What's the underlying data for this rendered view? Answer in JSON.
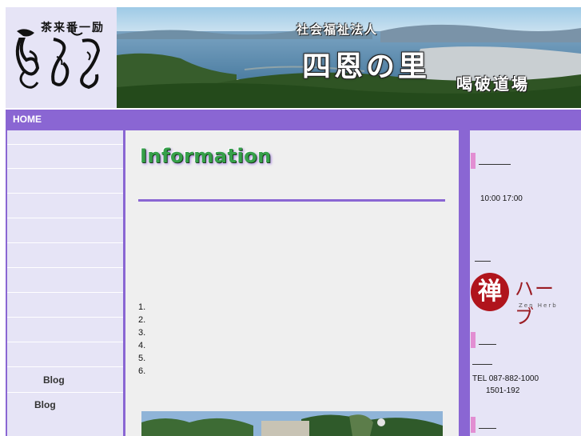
{
  "header": {
    "logo_name": "brush-calligraphy-logo",
    "banner_subtitle": "社会福祉法人",
    "banner_title": "四恩の里",
    "banner_dojo": "喝破道場"
  },
  "nav": {
    "home_label": "HOME"
  },
  "sidebar": {
    "items": [
      {
        "label": ""
      },
      {
        "label": ""
      },
      {
        "label": ""
      },
      {
        "label": ""
      },
      {
        "label": ""
      },
      {
        "label": ""
      },
      {
        "label": ""
      },
      {
        "label": ""
      },
      {
        "label": ""
      },
      {
        "label": ""
      },
      {
        "label": "Blog"
      },
      {
        "label": "Blog"
      }
    ]
  },
  "main": {
    "heading": "Information",
    "list_numbers": [
      "1.",
      "2.",
      "3.",
      "4.",
      "5.",
      "6."
    ]
  },
  "right": {
    "hours": "10:00 17:00",
    "zen_herb_kanji": "禅",
    "zen_herb_kana": "ハーブ",
    "zen_herb_en": "Zen Herb",
    "tel": "TEL 087-882-1000",
    "tel2": "1501-192"
  },
  "colors": {
    "accent": "#8a66d3",
    "panel": "#e6e4f6",
    "pink": "#e28ed2",
    "herb_red": "#b0141c"
  }
}
